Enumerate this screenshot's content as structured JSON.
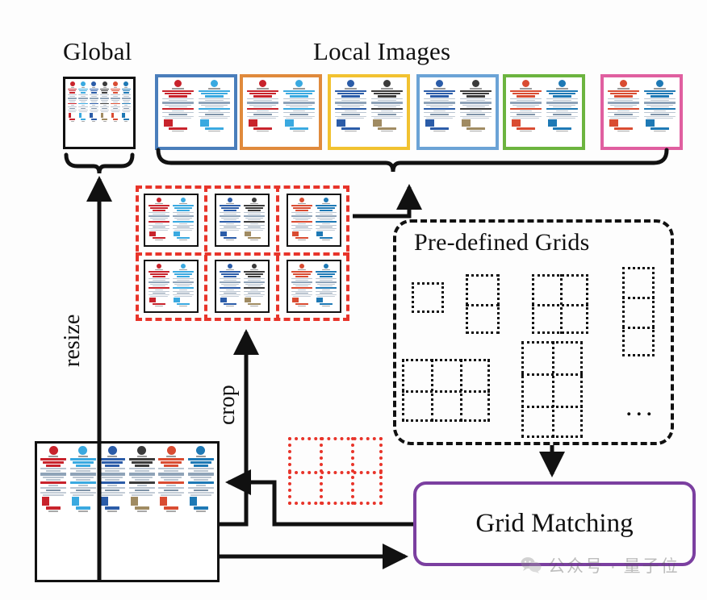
{
  "headings": {
    "global": "Global",
    "local_images": "Local Images",
    "predefined_grids": "Pre-defined Grids"
  },
  "labels": {
    "resize": "resize",
    "crop": "crop",
    "grid_matching": "Grid Matching",
    "ellipsis": "..."
  },
  "watermark": {
    "text": "公众号 · 量子位",
    "icon": "wechat-icon"
  },
  "colors": {
    "accent_red": "#e8342a",
    "accent_purple": "#7b3fa0",
    "outline_black": "#111111",
    "thumb_blue": "#4a7ebb",
    "thumb_orange": "#e08a3c",
    "thumb_yellow": "#f2c230",
    "thumb_lightblue": "#6ba3d6",
    "thumb_green": "#6cb43f",
    "thumb_pink": "#e05fa0"
  },
  "source_image": {
    "name": "social-media-infographic",
    "columns": [
      {
        "platform": "PINTEREST",
        "logo_color": "#c8232c",
        "headline": "SOCIAL SITE THAT IS ALL ABOUT DISCOVERY",
        "sub": "LARGEST OPPORTUNITIES",
        "stat_value": "70",
        "stat_unit": "MILLION",
        "stat_color": "#c8232c"
      },
      {
        "platform": "TWITTER",
        "logo_color": "#3aa9e0",
        "headline": "MICRO BLOGGING SOCIAL SITE THAT LIMITS EACH POST TO 140 CHARACTERS",
        "sub": "LARGEST PENETRATION",
        "stat_value": "560",
        "stat_unit": "MILLION",
        "stat_color": "#3aa9e0"
      },
      {
        "platform": "FACEBOOK",
        "logo_color": "#2b5ca8",
        "headline": "SOCIAL SHARING SITE THAT HAS 1 BILLION ACTIVE USERS",
        "sub": "LARGEST OPPORTUNITIES",
        "stat_value": "1",
        "stat_unit": "BILLION",
        "stat_color": "#2b5ca8"
      },
      {
        "platform": "INSTAGRAM",
        "logo_color": "#3b3b3b",
        "headline": "SOCIAL SHARING SITE ALL AROUND PICTURES AND VIDEOS",
        "sub": "MANY BRANDS",
        "stat_value": "150",
        "stat_unit": "MILLION",
        "stat_color": "#a08b62"
      },
      {
        "platform": "GOOGLE+",
        "logo_color": "#d94c32",
        "headline": "SOCIAL NETWORK BUILT BY GOOGLE THAT ALLOWS FOR BRANDS AND USERS",
        "sub": "TO BUILD CIRCLES",
        "stat_value": "400",
        "stat_unit": "MILLION",
        "stat_color": "#d94c32"
      },
      {
        "platform": "LINKEDIN",
        "logo_color": "#1e79b5",
        "headline": "BUSINESS ORIENTED SOCIAL NETWORKING SITE FOR CORPORATE BRANDS",
        "sub": "AND CONNECT",
        "stat_value": "240",
        "stat_unit": "MILLION",
        "stat_color": "#1e79b5"
      }
    ]
  },
  "local_images": [
    {
      "name": "local-image-1",
      "border_color": "#4a7ebb",
      "columns": [
        0,
        1
      ]
    },
    {
      "name": "local-image-2",
      "border_color": "#e08a3c",
      "columns": [
        0,
        1
      ]
    },
    {
      "name": "local-image-3",
      "border_color": "#f2c230",
      "columns": [
        2,
        3
      ]
    },
    {
      "name": "local-image-4",
      "border_color": "#6ba3d6",
      "columns": [
        2,
        3
      ]
    },
    {
      "name": "local-image-5",
      "border_color": "#6cb43f",
      "columns": [
        4,
        5
      ]
    },
    {
      "name": "local-image-6",
      "border_color": "#e05fa0",
      "columns": [
        4,
        5
      ]
    }
  ],
  "crop_grid": {
    "rows": 2,
    "cols": 3,
    "cells": [
      {
        "name": "crop-cell-1",
        "columns": [
          0,
          1
        ]
      },
      {
        "name": "crop-cell-2",
        "columns": [
          2,
          3
        ]
      },
      {
        "name": "crop-cell-3",
        "columns": [
          4,
          5
        ]
      },
      {
        "name": "crop-cell-4",
        "columns": [
          0,
          1
        ]
      },
      {
        "name": "crop-cell-5",
        "columns": [
          2,
          3
        ]
      },
      {
        "name": "crop-cell-6",
        "columns": [
          4,
          5
        ]
      }
    ]
  },
  "predefined_grids": [
    {
      "name": "grid-1x1",
      "cols": 1,
      "rows": 1
    },
    {
      "name": "grid-1x2",
      "cols": 1,
      "rows": 2
    },
    {
      "name": "grid-2x2",
      "cols": 2,
      "rows": 2
    },
    {
      "name": "grid-1x3",
      "cols": 1,
      "rows": 3
    },
    {
      "name": "grid-3x2",
      "cols": 3,
      "rows": 2
    },
    {
      "name": "grid-2x3",
      "cols": 2,
      "rows": 3
    }
  ],
  "selected_grid": {
    "name": "selected-grid-3x2",
    "cols": 3,
    "rows": 2
  }
}
